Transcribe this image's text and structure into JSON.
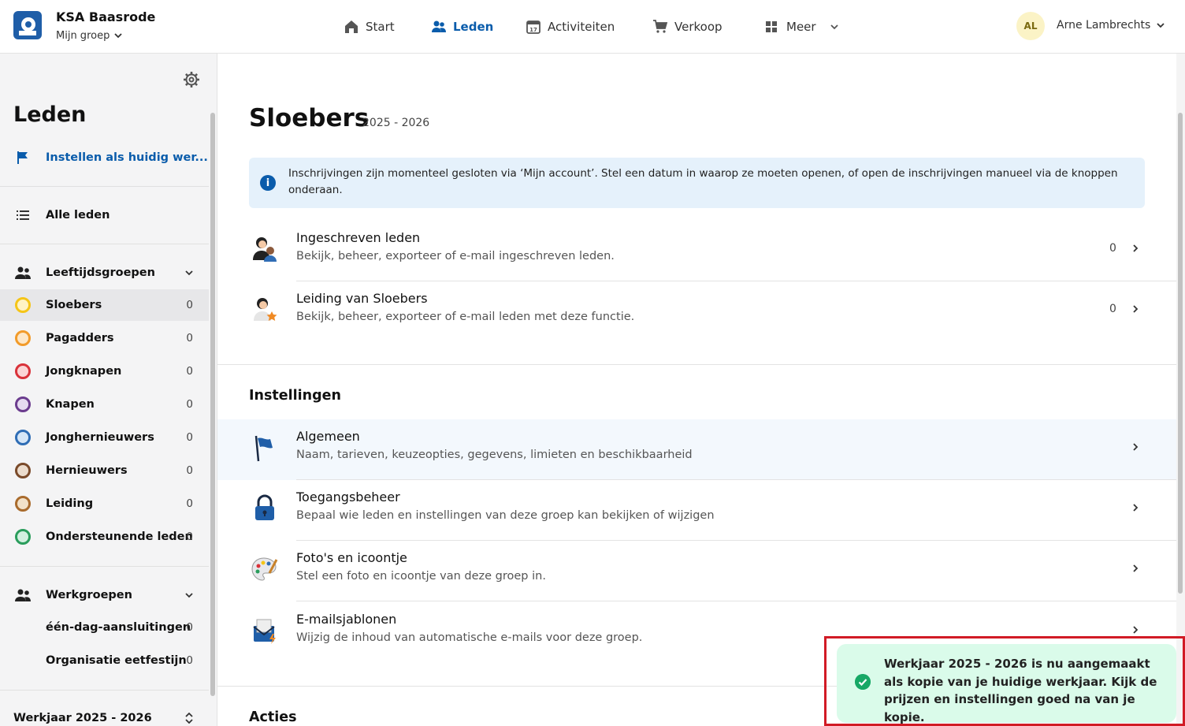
{
  "header": {
    "org_name": "KSA Baasrode",
    "group_selector": "Mijn groep",
    "nav": [
      {
        "label": "Start",
        "icon": "home-icon"
      },
      {
        "label": "Leden",
        "icon": "members-icon",
        "active": true
      },
      {
        "label": "Activiteiten",
        "icon": "calendar-icon"
      },
      {
        "label": "Verkoop",
        "icon": "cart-icon"
      },
      {
        "label": "Meer",
        "icon": "grid-icon"
      }
    ],
    "calendar_day": "17",
    "user": {
      "initials": "AL",
      "name": "Arne Lambrechts"
    }
  },
  "sidebar": {
    "title": "Leden",
    "set_current": "Instellen als huidig wer...",
    "all_members": "Alle leden",
    "age_groups_title": "Leeftijdsgroepen",
    "age_groups": [
      {
        "label": "Sloebers",
        "count": "0",
        "color": "#f5c518"
      },
      {
        "label": "Pagadders",
        "count": "0",
        "color": "#f29b2a"
      },
      {
        "label": "Jongknapen",
        "count": "0",
        "color": "#d9323a"
      },
      {
        "label": "Knapen",
        "count": "0",
        "color": "#6b3c8e"
      },
      {
        "label": "Jonghernieuwers",
        "count": "0",
        "color": "#2f6db5"
      },
      {
        "label": "Hernieuwers",
        "count": "0",
        "color": "#7a4a2a"
      },
      {
        "label": "Leiding",
        "count": "0",
        "color": "#a96b2d"
      },
      {
        "label": "Ondersteunende leden",
        "count": "0",
        "color": "#2a9d5c"
      }
    ],
    "work_groups_title": "Werkgroepen",
    "work_groups": [
      {
        "label": "één-dag-aansluitingen",
        "count": "0"
      },
      {
        "label": "Organisatie eetfestijn",
        "count": "0"
      }
    ],
    "year_selector": "Werkjaar 2025 - 2026"
  },
  "main": {
    "title": "Sloebers",
    "subtitle": "2025 - 2026",
    "info_text": "Inschrijvingen zijn momenteel gesloten via ‘Mijn account’. Stel een datum in waarop ze moeten openen, of open de inschrijvingen manueel via de knoppen onderaan.",
    "member_rows": [
      {
        "title": "Ingeschreven leden",
        "desc": "Bekijk, beheer, exporteer of e-mail ingeschreven leden.",
        "count": "0"
      },
      {
        "title": "Leiding van Sloebers",
        "desc": "Bekijk, beheer, exporteer of e-mail leden met deze functie.",
        "count": "0"
      }
    ],
    "settings_title": "Instellingen",
    "settings_rows": [
      {
        "title": "Algemeen",
        "desc": "Naam, tarieven, keuzeopties, gegevens, limieten en beschikbaarheid"
      },
      {
        "title": "Toegangsbeheer",
        "desc": "Bepaal wie leden en instellingen van deze groep kan bekijken of wijzigen"
      },
      {
        "title": "Foto's en icoontje",
        "desc": "Stel een foto en icoontje van deze groep in."
      },
      {
        "title": "E-mailsjablonen",
        "desc": "Wijzig de inhoud van automatische e-mails voor deze groep."
      }
    ],
    "actions_title": "Acties"
  },
  "toast": {
    "message": "Werkjaar 2025 - 2026 is nu aangemaakt als kopie van je huidige werkjaar. Kijk de prijzen en instellingen goed na van je kopie."
  },
  "colors": {
    "accent": "#0a5cab",
    "toast_bg": "#dafbea",
    "success": "#17a866",
    "highlight_frame": "#d11b25"
  }
}
